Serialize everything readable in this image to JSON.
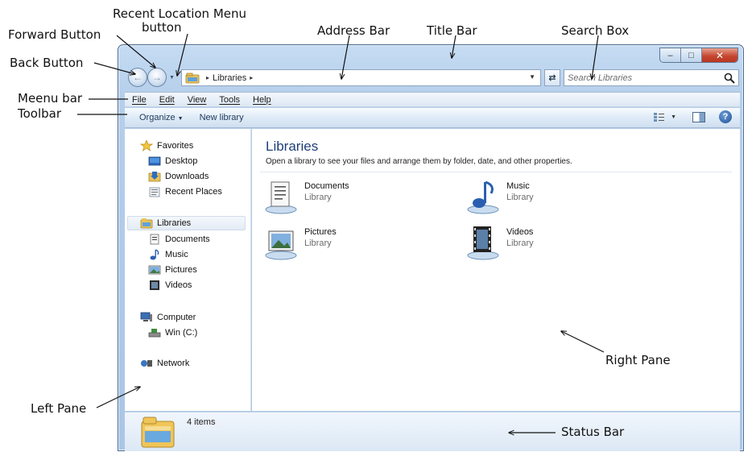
{
  "annotations": {
    "forward_button": "Forward Button",
    "recent_location_line1": "Recent Location Menu",
    "recent_location_line2": "button",
    "address_bar": "Address Bar",
    "title_bar": "Title Bar",
    "search_box": "Search Box",
    "back_button": "Back Button",
    "menu_bar": "Meenu bar",
    "toolbar": "Toolbar",
    "right_pane": "Right Pane",
    "left_pane": "Left Pane",
    "status_bar": "Status Bar"
  },
  "window": {
    "controls": {
      "minimize": "–",
      "maximize": "□",
      "close": "✕"
    }
  },
  "nav": {
    "back_glyph": "←",
    "forward_glyph": "→",
    "recent_glyph": "▼",
    "refresh_glyph": "⇄"
  },
  "address": {
    "sep": "▸",
    "location": "Libraries",
    "dropdown_glyph": "▼"
  },
  "search": {
    "placeholder": "Search Libraries"
  },
  "menu": [
    "File",
    "Edit",
    "View",
    "Tools",
    "Help"
  ],
  "toolbar": {
    "organize_label": "Organize",
    "organize_caret": "▼",
    "new_library_label": "New library",
    "views_caret": "▼",
    "help_glyph": "?"
  },
  "left_pane": {
    "favorites": "Favorites",
    "desktop": "Desktop",
    "downloads": "Downloads",
    "recent_places": "Recent Places",
    "libraries": "Libraries",
    "documents": "Documents",
    "music": "Music",
    "pictures": "Pictures",
    "videos": "Videos",
    "computer": "Computer",
    "win_c": "Win (C:)",
    "network": "Network"
  },
  "right_pane": {
    "title": "Libraries",
    "subtitle": "Open a library to see your files and arrange them by folder, date, and other properties.",
    "libraries": [
      {
        "name": "Documents",
        "type": "Library",
        "icon": "documents-library-icon"
      },
      {
        "name": "Music",
        "type": "Library",
        "icon": "music-library-icon"
      },
      {
        "name": "Pictures",
        "type": "Library",
        "icon": "pictures-library-icon"
      },
      {
        "name": "Videos",
        "type": "Library",
        "icon": "videos-library-icon"
      }
    ]
  },
  "status": {
    "count": "4 items"
  }
}
